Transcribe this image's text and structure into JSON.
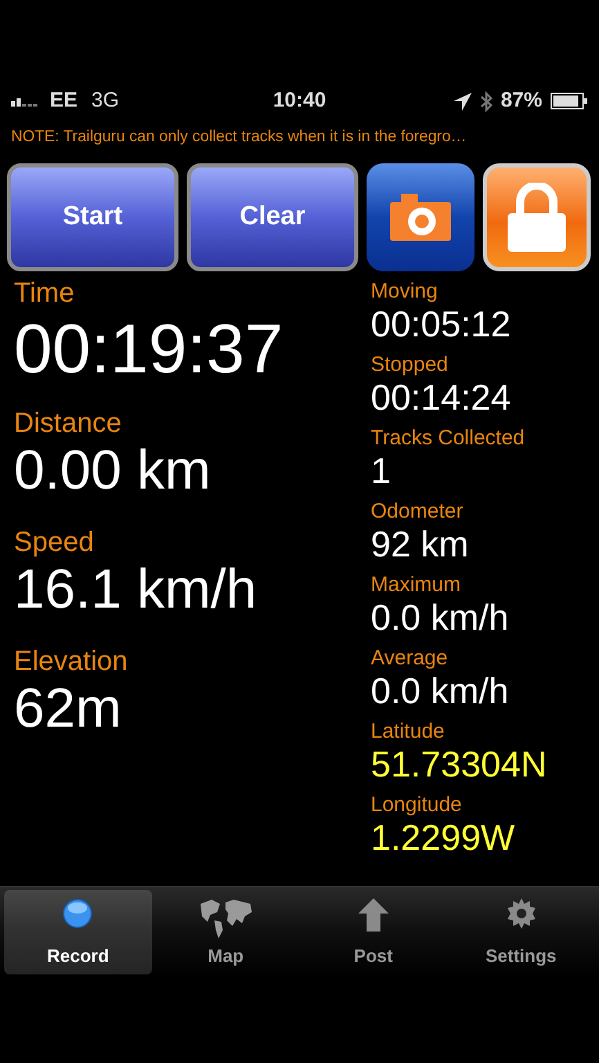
{
  "status_bar": {
    "carrier": "EE",
    "network": "3G",
    "time": "10:40",
    "battery": "87%"
  },
  "note": "NOTE: Trailguru can only collect tracks when it is in the foregro…",
  "buttons": [
    {
      "kind": "text",
      "label": "Start"
    },
    {
      "kind": "text",
      "label": "Clear"
    },
    {
      "kind": "camera"
    },
    {
      "kind": "lock"
    }
  ],
  "main_stats": [
    {
      "label": "Time",
      "value": "00:19:37",
      "kind": "large"
    },
    {
      "label": "Distance",
      "value": "0.00 km",
      "kind": "medium"
    },
    {
      "label": "Speed",
      "value": "16.1 km/h",
      "kind": "medium"
    },
    {
      "label": "Elevation",
      "value": "62m",
      "kind": "medium"
    }
  ],
  "side_stats": [
    {
      "label": "Moving",
      "value": "00:05:12",
      "color": "#ffffff"
    },
    {
      "label": "Stopped",
      "value": "00:14:24",
      "color": "#ffffff"
    },
    {
      "label": "Tracks Collected",
      "value": "1",
      "color": "#ffffff"
    },
    {
      "label": "Odometer",
      "value": "92 km",
      "color": "#ffffff"
    },
    {
      "label": "Maximum",
      "value": "0.0 km/h",
      "color": "#ffffff"
    },
    {
      "label": "Average",
      "value": "0.0 km/h",
      "color": "#ffffff"
    },
    {
      "label": "Latitude",
      "value": "51.73304N",
      "color": "#ffff33"
    },
    {
      "label": "Longitude",
      "value": "1.2299W",
      "color": "#ffff33"
    }
  ],
  "tabs": [
    {
      "label": "Record",
      "kind": "record",
      "selected": true
    },
    {
      "label": "Map",
      "kind": "map",
      "selected": false
    },
    {
      "label": "Post",
      "kind": "post",
      "selected": false
    },
    {
      "label": "Settings",
      "kind": "settings",
      "selected": false
    }
  ]
}
